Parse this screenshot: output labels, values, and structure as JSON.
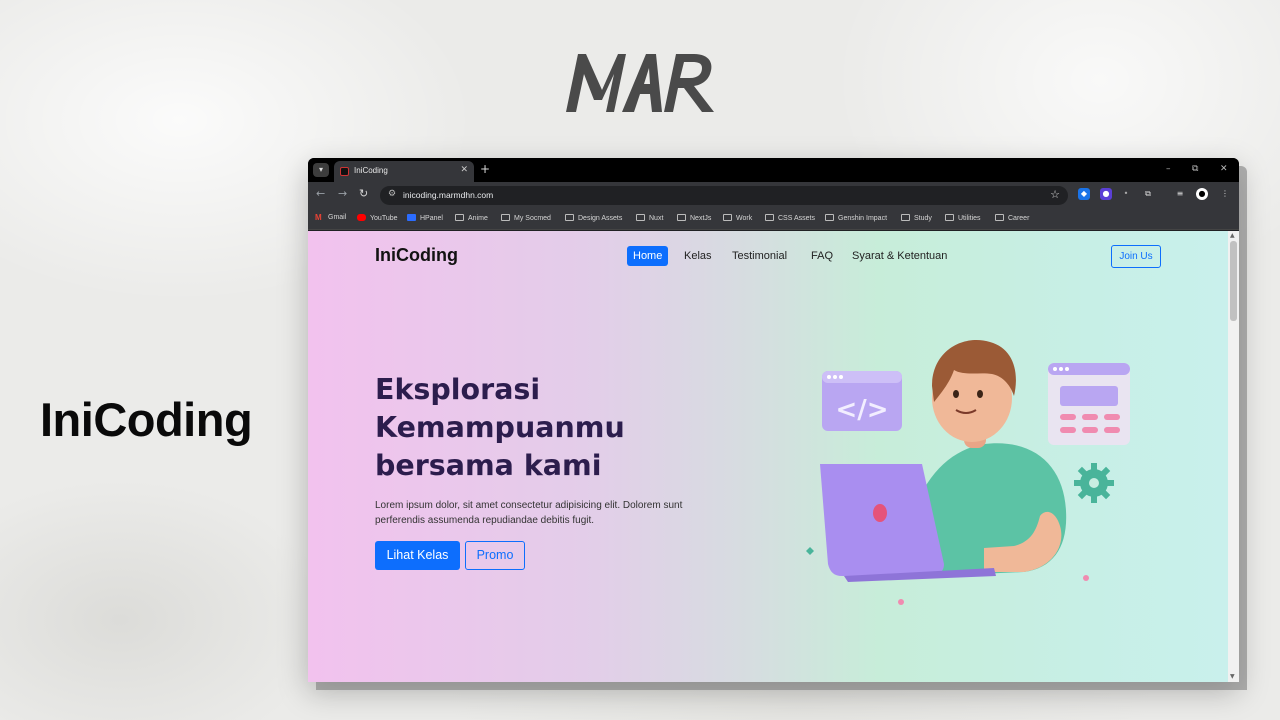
{
  "brand_logo": {
    "text": "MAR",
    "color": "#4a4a4a"
  },
  "side_title": "IniCoding",
  "browser": {
    "tab_title": "IniCoding",
    "tab_close": "✕",
    "new_tab": "+",
    "window_controls": {
      "minimize": "–",
      "restore": "⧉",
      "close": "✕"
    },
    "url": "inicoding.marmdhn.com",
    "bookmarks": [
      {
        "label": "Gmail",
        "icon": "gmail-icon"
      },
      {
        "label": "YouTube",
        "icon": "youtube-icon"
      },
      {
        "label": "HPanel",
        "icon": "hpanel-icon"
      },
      {
        "label": "Anime",
        "icon": "folder-icon"
      },
      {
        "label": "My Socmed",
        "icon": "folder-icon"
      },
      {
        "label": "Design Assets",
        "icon": "folder-icon"
      },
      {
        "label": "Nuxt",
        "icon": "folder-icon"
      },
      {
        "label": "NextJs",
        "icon": "folder-icon"
      },
      {
        "label": "Work",
        "icon": "folder-icon"
      },
      {
        "label": "CSS Assets",
        "icon": "folder-icon"
      },
      {
        "label": "Genshin Impact",
        "icon": "folder-icon"
      },
      {
        "label": "Study",
        "icon": "folder-icon"
      },
      {
        "label": "Utilities",
        "icon": "folder-icon"
      },
      {
        "label": "Career",
        "icon": "folder-icon"
      }
    ]
  },
  "site": {
    "brand": "IniCoding",
    "nav": [
      "Home",
      "Kelas",
      "Testimonial",
      "FAQ",
      "Syarat & Ketentuan"
    ],
    "active_nav": "Home",
    "join_label": "Join Us",
    "hero": {
      "title": "Eksplorasi Kemampuanmu bersama kami",
      "description": "Lorem ipsum dolor, sit amet consectetur adipisicing elit. Dolorem sunt perferendis assumenda repudiandae debitis fugit.",
      "primary_button": "Lihat Kelas",
      "secondary_button": "Promo"
    },
    "colors": {
      "accent": "#0d6efd",
      "title": "#2c1d4d"
    }
  }
}
